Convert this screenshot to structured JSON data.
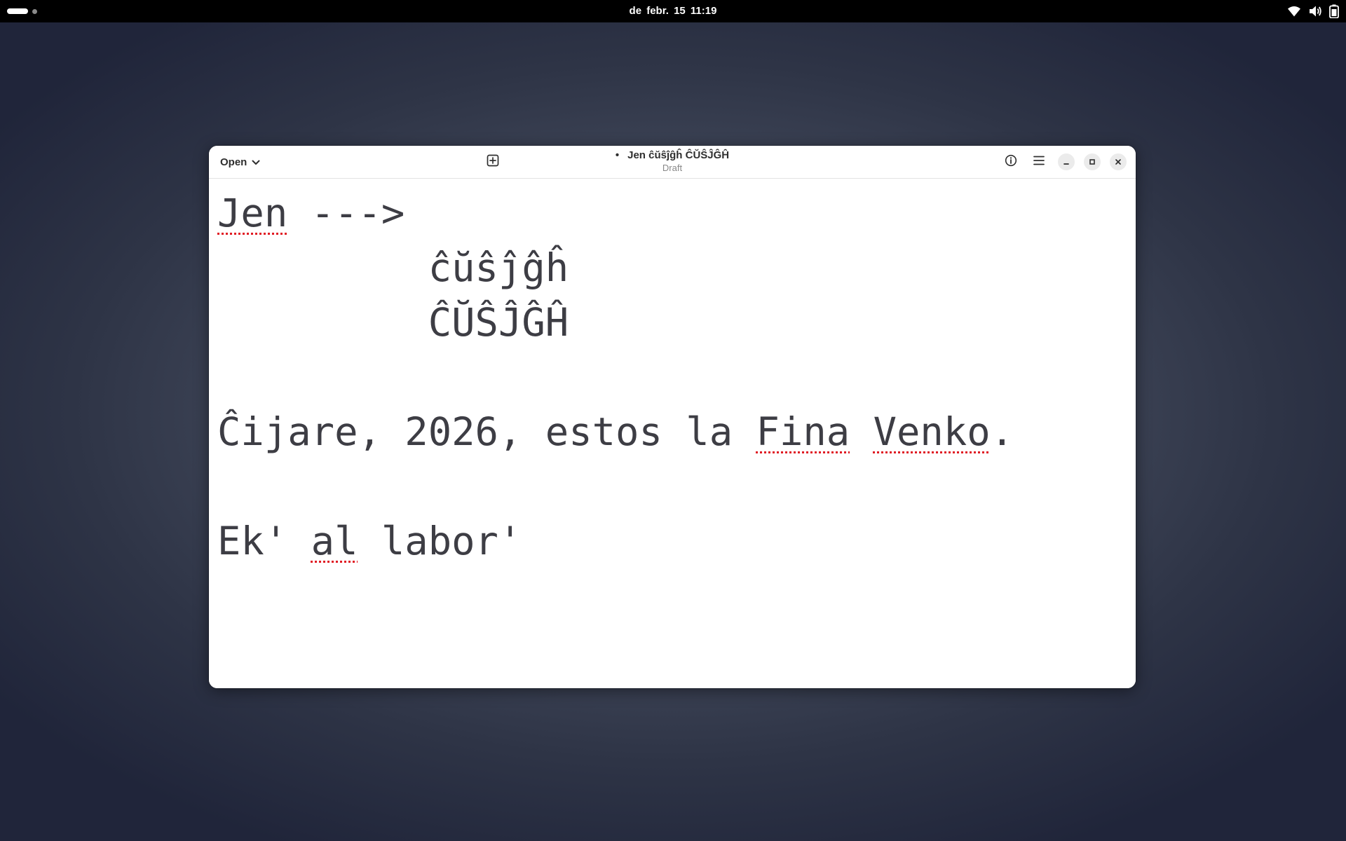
{
  "topbar": {
    "clock": "de febr. 15  11:19",
    "icons": [
      "wifi-icon",
      "volume-icon",
      "battery-icon"
    ]
  },
  "window": {
    "open_label": "Open",
    "title": "Jen ĉŭŝĵĝĥ ĈŬŜĴĜĤ",
    "modified_indicator": "•",
    "subtitle": "Draft",
    "buttons": [
      "new-tab-icon",
      "info-icon",
      "hamburger-menu-icon",
      "minimize-icon",
      "maximize-icon",
      "close-icon"
    ]
  },
  "editor": {
    "lines": {
      "l1a": "Jen",
      "l1b": " --->",
      "l2": "         ĉŭŝĵĝĥ",
      "l3": "         ĈŬŜĴĜĤ",
      "l5a": "Ĉijare, 2026, estos la ",
      "l5b": "Fina",
      "l5c": " ",
      "l5d": "Venko",
      "l5e": ".",
      "l7a": "Ek' ",
      "l7b": "al",
      "l7c": " labor'"
    },
    "spell_error_color": "#e01b24"
  },
  "colors": {
    "topbar_bg": "#000000",
    "text": "#3d3d44",
    "window_bg": "#ffffff"
  }
}
